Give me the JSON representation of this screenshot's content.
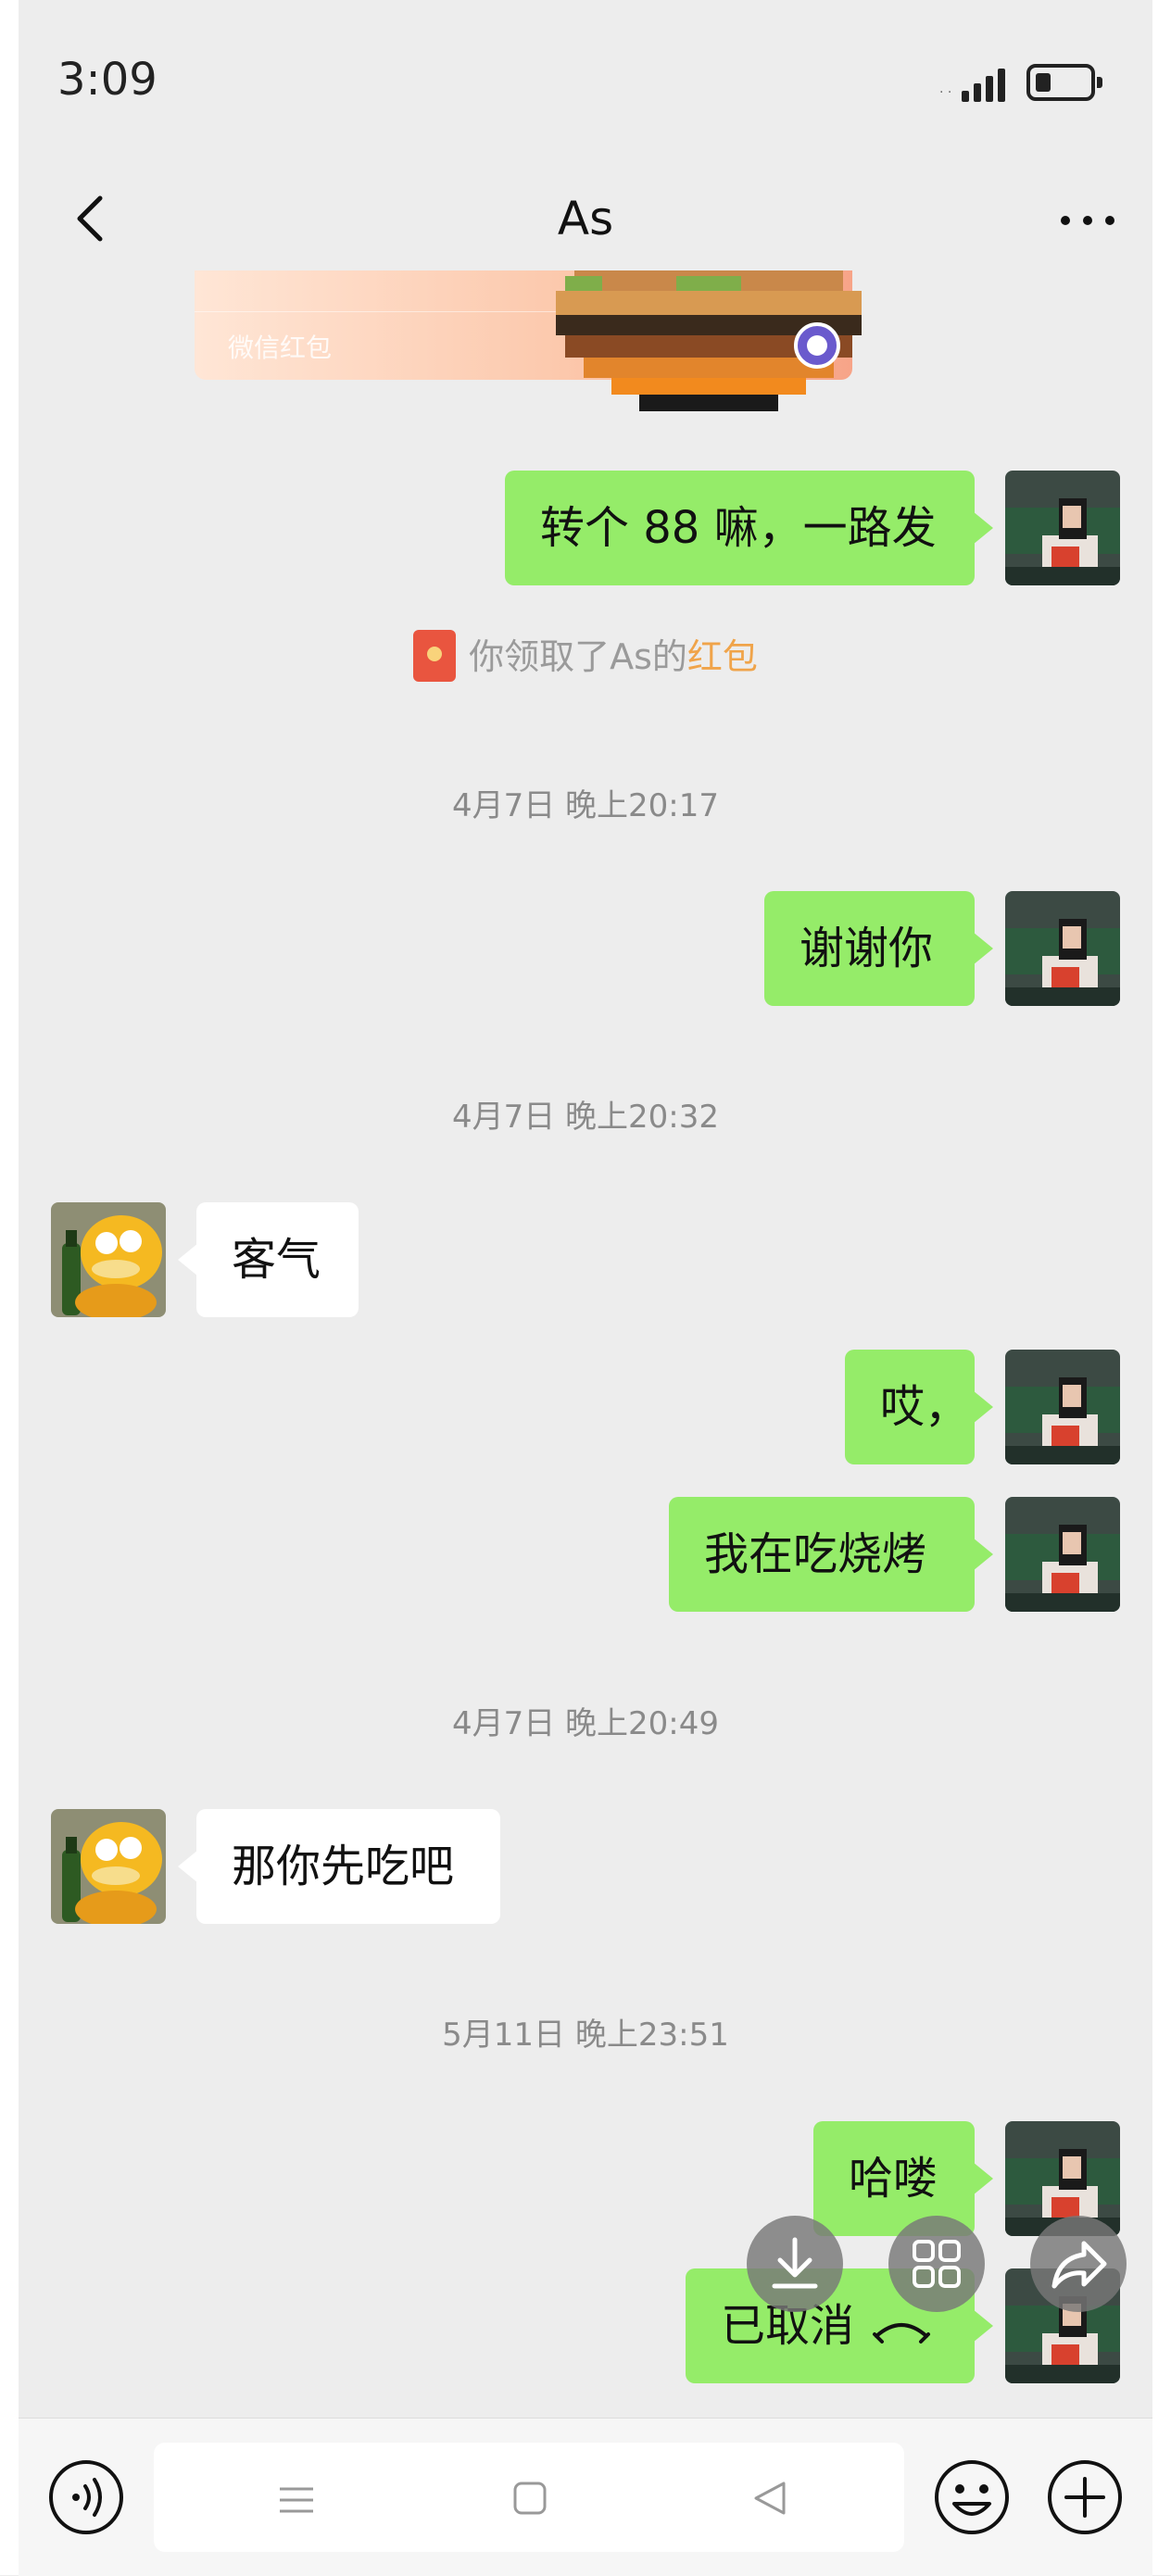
{
  "status_bar": {
    "time": "3:09"
  },
  "header": {
    "title": "As"
  },
  "red_packet": {
    "label": "微信红包"
  },
  "messages": [
    {
      "side": "me",
      "text": "转个 88 嘛，一路发"
    },
    {
      "side": "me",
      "text": "谢谢你"
    },
    {
      "side": "them",
      "text": "客气"
    },
    {
      "side": "me",
      "text": "哎，"
    },
    {
      "side": "me",
      "text": "我在吃烧烤"
    },
    {
      "side": "them",
      "text": "那你先吃吧"
    },
    {
      "side": "me",
      "text": "哈喽"
    },
    {
      "side": "me",
      "text": "已取消"
    }
  ],
  "system_notice": {
    "prefix": "你领取了As的",
    "link": "红包"
  },
  "timestamps": [
    "4月7日 晚上20:17",
    "4月7日 晚上20:32",
    "4月7日 晚上20:49",
    "5月11日 晚上23:51"
  ],
  "colors": {
    "sent_bubble": "#95ec69",
    "received_bubble": "#ffffff",
    "background": "#ededed",
    "link": "#f0a44a"
  },
  "icons": [
    "back-icon",
    "more-icon",
    "voice-icon",
    "emoji-icon",
    "plus-icon",
    "download-icon",
    "multi-select-icon",
    "forward-icon",
    "call-cancelled-icon"
  ]
}
